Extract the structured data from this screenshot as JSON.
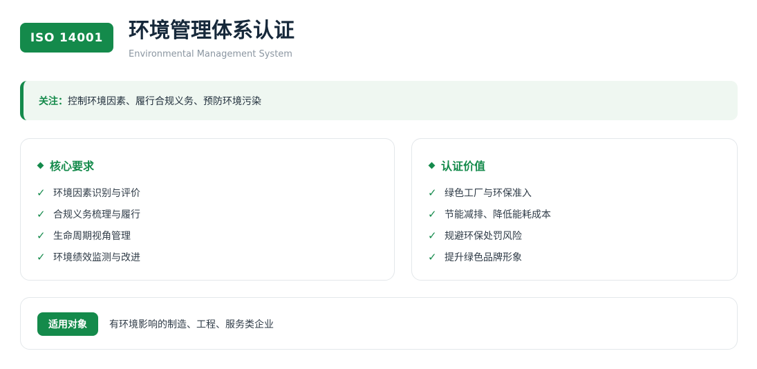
{
  "header": {
    "badge": "ISO 14001",
    "title": "环境管理体系认证",
    "subtitle": "Environmental Management System"
  },
  "focus": {
    "label": "关注：",
    "text": "控制环境因素、履行合规义务、预防环境污染"
  },
  "requirements": {
    "title": "核心要求",
    "items": [
      "环境因素识别与评价",
      "合规义务梳理与履行",
      "生命周期视角管理",
      "环境绩效监测与改进"
    ]
  },
  "value": {
    "title": "认证价值",
    "items": [
      "绿色工厂与环保准入",
      "节能减排、降低能耗成本",
      "规避环保处罚风险",
      "提升绿色品牌形象"
    ]
  },
  "applicable": {
    "tag": "适用对象",
    "text": "有环境影响的制造、工程、服务类企业"
  },
  "icons": {
    "bullet": "diamond-icon",
    "check": "check-icon"
  },
  "colors": {
    "accent": "#148a4b",
    "focus_bg": "#eff7f1",
    "title": "#16283a",
    "muted": "#8b96a1"
  }
}
